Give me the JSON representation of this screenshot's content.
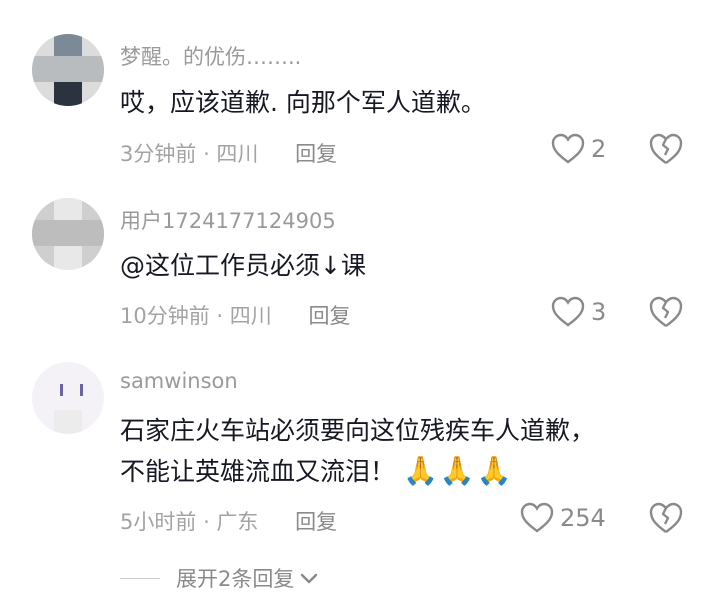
{
  "comments": [
    {
      "username": "梦醒。的优伤……..",
      "lines": [
        "哎，应该道歉. 向那个军人道歉。"
      ],
      "time": "3分钟前",
      "location": "四川",
      "reply_label": "回复",
      "likes": "2"
    },
    {
      "username": "用户1724177124905",
      "lines": [
        "@这位工作员必须↓课"
      ],
      "time": "10分钟前",
      "location": "四川",
      "reply_label": "回复",
      "likes": "3"
    },
    {
      "username": "samwinson",
      "lines": [
        "石家庄火车站必须要向这位残疾车人道歉，",
        "不能让英雄流血又流泪！"
      ],
      "emoji": "🙏🙏🙏",
      "time": "5小时前",
      "location": "广东",
      "reply_label": "回复",
      "likes": "254"
    }
  ],
  "expand_replies": "展开2条回复",
  "colors": {
    "text": "#161823",
    "muted": "#a3a3a3",
    "icon": "#8a8a8a"
  }
}
